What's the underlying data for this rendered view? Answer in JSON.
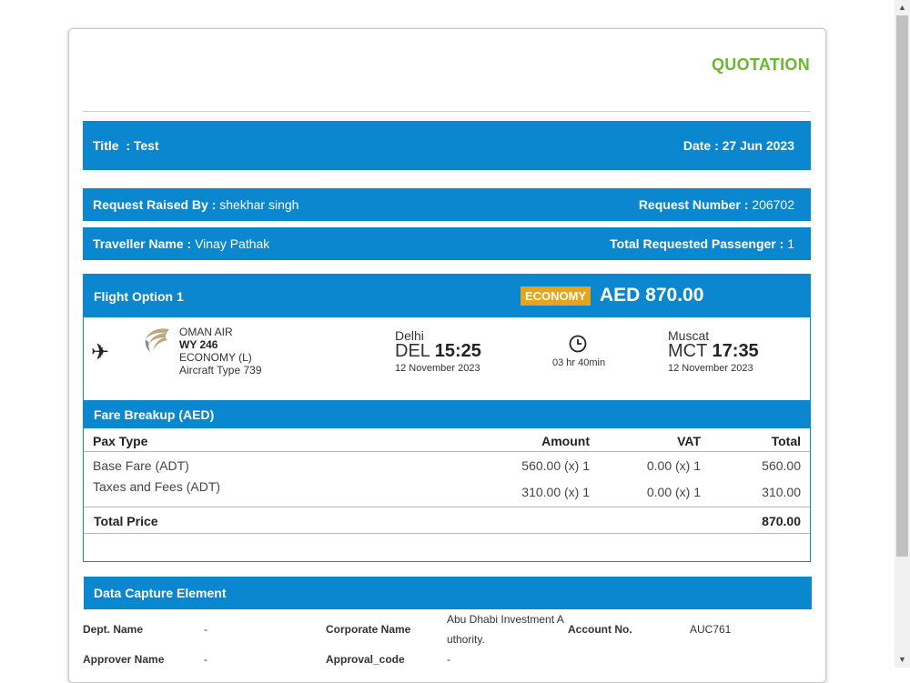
{
  "header": {
    "title": "QUOTATION"
  },
  "info": {
    "title_label": "Title",
    "title_value": ": Test",
    "date_label": "Date : 27 Jun 2023",
    "raised_label": "Request Raised By :",
    "raised_value": "shekhar singh",
    "reqnum_label": "Request Number :",
    "reqnum_value": "206702",
    "traveller_label": "Traveller Name :",
    "traveller_value": "Vinay Pathak",
    "pax_label": "Total Requested Passenger :",
    "pax_value": "1"
  },
  "flight": {
    "option_label": "Flight Option 1",
    "cabin_badge": "ECONOMY",
    "price": "AED 870.00",
    "airline": "OMAN AIR",
    "flight_no": "WY 246",
    "cabin": "ECONOMY (L)",
    "aircraft": "Aircraft Type 739",
    "from_city": "Delhi",
    "from_code": "DEL",
    "from_time": "15:25",
    "from_date": "12 November 2023",
    "duration": "03 hr 40min",
    "to_city": "Muscat",
    "to_code": "MCT",
    "to_time": "17:35",
    "to_date": "12 November 2023"
  },
  "fare": {
    "heading": "Fare Breakup (AED)",
    "columns": {
      "pax": "Pax Type",
      "amount": "Amount",
      "vat": "VAT",
      "total": "Total"
    },
    "rows": [
      {
        "pax": "Base Fare (ADT)",
        "amount": "560.00 (x) 1",
        "vat": "0.00 (x) 1",
        "total": "560.00"
      },
      {
        "pax": "Taxes and Fees (ADT)",
        "amount": "310.00 (x) 1",
        "vat": "0.00 (x) 1",
        "total": "310.00"
      }
    ],
    "total_label": "Total Price",
    "total_value": "870.00"
  },
  "dce": {
    "heading": "Data Capture Element",
    "dept_label": "Dept. Name",
    "dept_value": "-",
    "corp_label": "Corporate Name",
    "corp_value_1": "Abu Dhabi Investment A",
    "corp_value_2": "uthority.",
    "account_label": "Account No.",
    "account_value": "AUC761",
    "approver_label": "Approver Name",
    "approver_value": "-",
    "approval_label": "Approval_code",
    "approval_value": "-"
  },
  "colors": {
    "band": "#0a87cf",
    "title": "#69b830",
    "badge": "#e8a31c"
  },
  "icons": [
    "plane-icon",
    "airline-logo",
    "clock-icon",
    "scroll-up-arrow",
    "scroll-down-arrow"
  ]
}
